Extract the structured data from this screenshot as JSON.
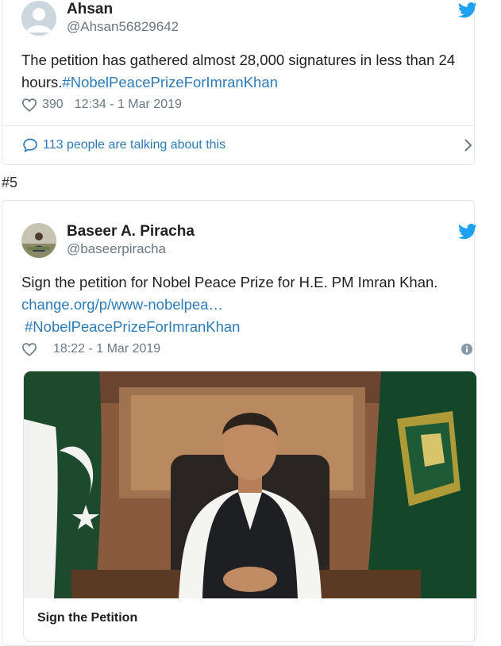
{
  "tweet1": {
    "name": "Ahsan",
    "handle": "@Ahsan56829642",
    "text": "The petition has gathered almost 28,000 signatures in less than 24 hours.",
    "hashtag": "#NobelPeacePrizeForImranKhan",
    "likes": "390",
    "timestamp": "12:34 - 1 Mar 2019",
    "talking": "113 people are talking about this"
  },
  "marker": "#5",
  "tweet2": {
    "name": "Baseer A. Piracha",
    "handle": "@baseerpiracha",
    "text": "Sign the petition for Nobel Peace Prize for H.E. PM Imran Khan.",
    "link": "change.org/p/www-nobelpea…",
    "hashtag": "#NobelPeacePrizeForImranKhan",
    "timestamp": "18:22 - 1 Mar 2019",
    "card_title": "Sign the Petition"
  },
  "colors": {
    "link": "#2b7bb9",
    "twitter_blue": "#1da1f2",
    "muted": "#697882",
    "border": "#e1e8ed"
  },
  "icons": [
    "avatar-placeholder",
    "twitter-bird-icon",
    "heart-icon",
    "speech-bubble-icon",
    "chevron-right-icon",
    "info-icon"
  ]
}
